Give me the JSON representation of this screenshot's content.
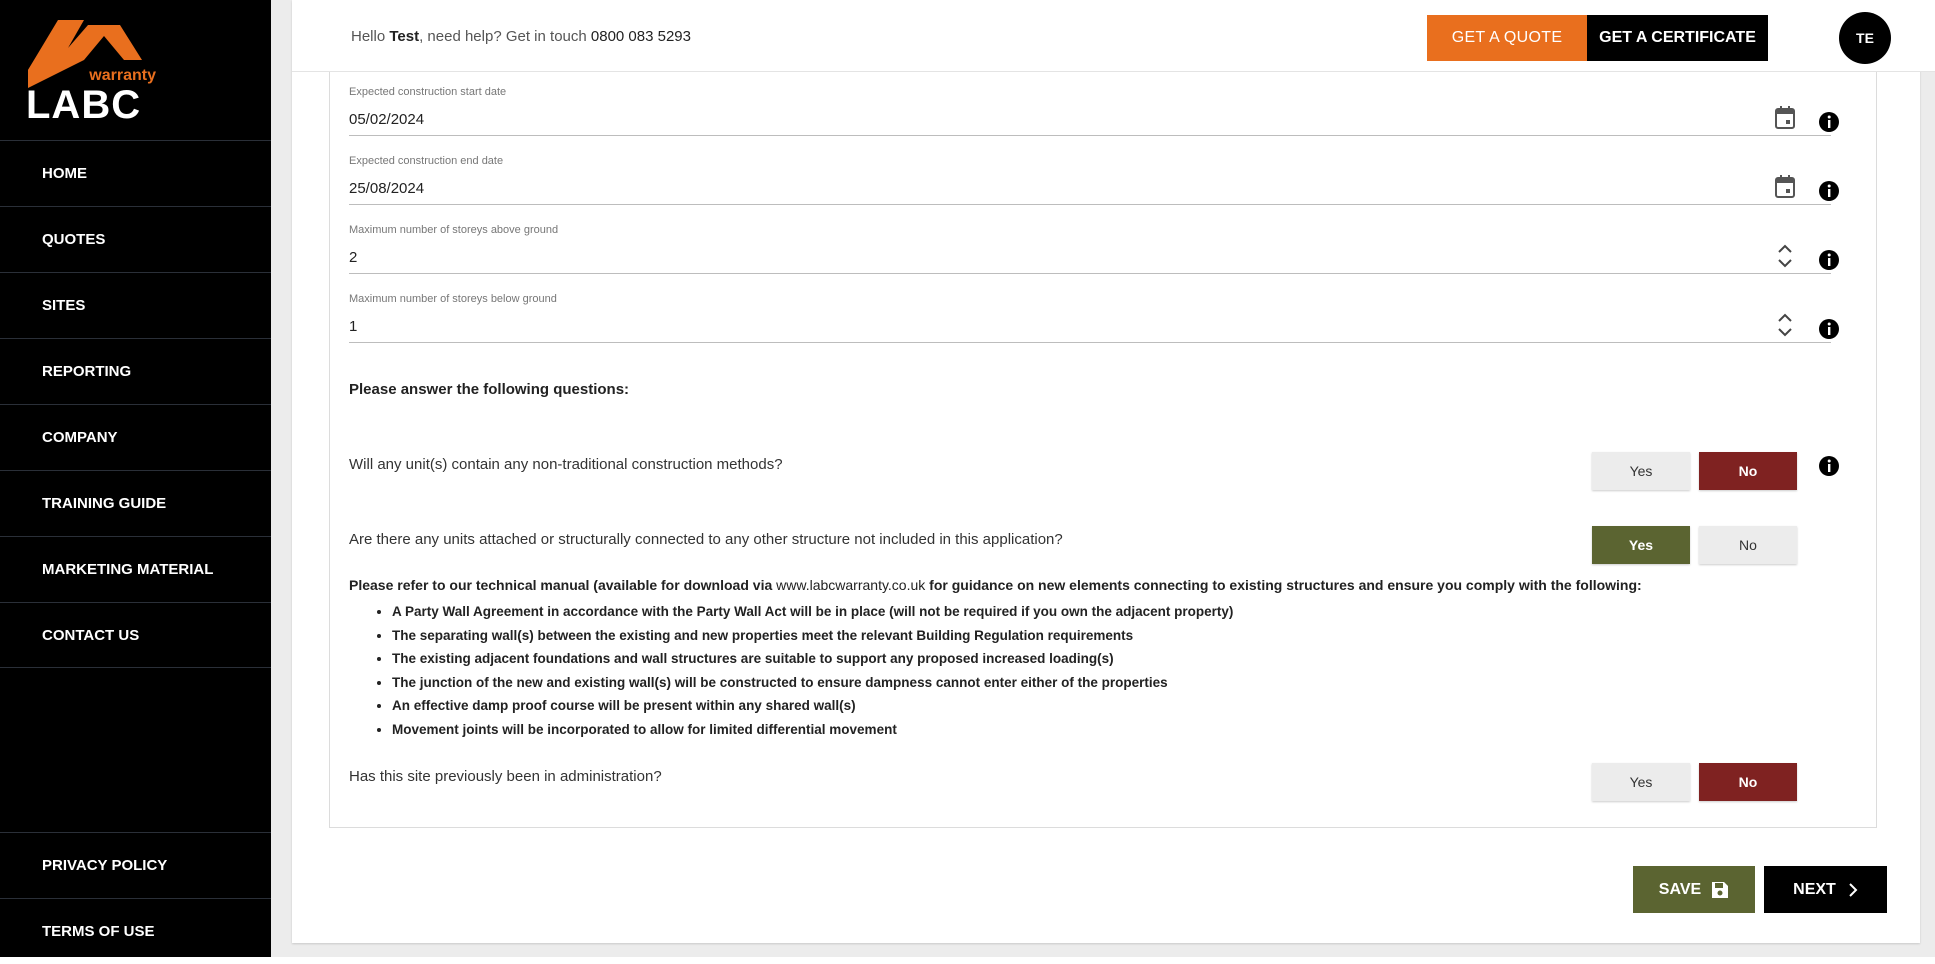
{
  "brand": {
    "logo_small_text": "warranty",
    "logo_big_text": "LABC",
    "accent_color": "#e96f1e"
  },
  "sidebar": {
    "items": [
      {
        "label": "HOME"
      },
      {
        "label": "QUOTES"
      },
      {
        "label": "SITES"
      },
      {
        "label": "REPORTING"
      },
      {
        "label": "COMPANY"
      },
      {
        "label": "TRAINING GUIDE"
      },
      {
        "label": "MARKETING MATERIAL"
      },
      {
        "label": "CONTACT US"
      }
    ],
    "footer_items": [
      {
        "label": "PRIVACY POLICY"
      },
      {
        "label": "TERMS OF USE"
      }
    ]
  },
  "header": {
    "greeting_prefix": "Hello",
    "user_name": "Test",
    "help_text": ", need help? Get in touch",
    "phone": "0800 083 5293",
    "quote_button": "GET A QUOTE",
    "certificate_button": "GET A CERTIFICATE",
    "avatar_initials": "TE"
  },
  "form": {
    "fields": [
      {
        "label": "Expected construction start date",
        "value": "05/02/2024",
        "icon": "calendar-icon"
      },
      {
        "label": "Expected construction end date",
        "value": "25/08/2024",
        "icon": "calendar-icon"
      },
      {
        "label": "Maximum number of storeys above ground",
        "value": "2",
        "icon": "stepper-icon"
      },
      {
        "label": "Maximum number of storeys below ground",
        "value": "1",
        "icon": "stepper-icon"
      }
    ],
    "questions_heading": "Please answer the following questions:",
    "questions": [
      {
        "text": "Will any unit(s) contain any non-traditional construction methods?",
        "yes": "Yes",
        "no": "No",
        "selected": "No"
      },
      {
        "text": "Are there any units attached or structurally connected to any other structure not included in this application?",
        "yes": "Yes",
        "no": "No",
        "selected": "Yes"
      },
      {
        "text": "Has this site previously been in administration?",
        "yes": "Yes",
        "no": "No",
        "selected": "No"
      }
    ],
    "note_prefix": "Please refer to our technical manual (available for download via",
    "note_link": "www.labcwarranty.co.uk",
    "note_suffix": "for guidance on new elements connecting to existing structures and ensure you comply with the following:",
    "bullets": [
      "A Party Wall Agreement in accordance with the Party Wall Act will be in place (will not be required if you own the adjacent property)",
      "The separating wall(s) between the existing and new properties meet the relevant Building Regulation requirements",
      "The existing adjacent foundations and wall structures are suitable to support any proposed increased loading(s)",
      "The junction of the new and existing wall(s) will be constructed to ensure dampness cannot enter either of the properties",
      "An effective damp proof course will be present within any shared wall(s)",
      "Movement joints will be incorporated to allow for limited differential movement"
    ]
  },
  "actions": {
    "save_label": "SAVE",
    "next_label": "NEXT"
  }
}
